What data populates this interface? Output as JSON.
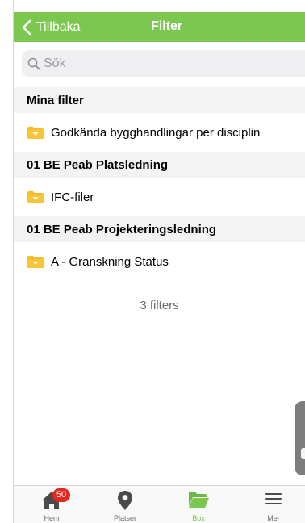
{
  "nav": {
    "back_label": "Tillbaka",
    "title": "Filter",
    "bar_color": "#7bc74f"
  },
  "search": {
    "placeholder": "Sök",
    "value": ""
  },
  "sections": [
    {
      "header": "Mina filter",
      "items": [
        {
          "label": "Godkända bygghandlingar per disciplin",
          "icon": "filter-folder-icon"
        }
      ]
    },
    {
      "header": "01 BE Peab Platsledning",
      "items": [
        {
          "label": "IFC-filer",
          "icon": "filter-folder-icon"
        }
      ]
    },
    {
      "header": "01 BE Peab Projekteringsledning",
      "items": [
        {
          "label": "A - Granskning Status",
          "icon": "filter-folder-icon"
        }
      ]
    }
  ],
  "count_text": "3 filters",
  "tab_bar": {
    "tabs": [
      {
        "label": "Hem",
        "icon": "home-icon",
        "badge": "50"
      },
      {
        "label": "Platser",
        "icon": "map-pin-icon"
      },
      {
        "label": "Box",
        "icon": "open-folder-icon",
        "active": true
      },
      {
        "label": "Mer",
        "icon": "menu-icon"
      }
    ]
  },
  "colors": {
    "accent": "#7bc74f",
    "badge": "#e4281f",
    "folder": "#f5bd2e"
  }
}
